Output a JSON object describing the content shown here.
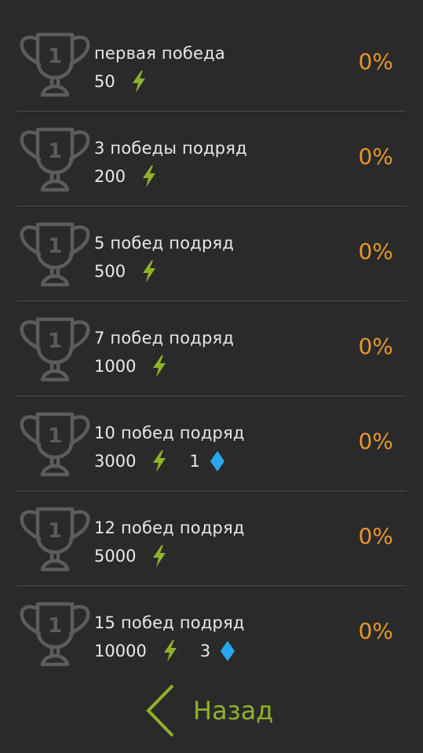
{
  "achievements": [
    {
      "title": "первая победа",
      "energy": "50",
      "gems": "",
      "progress": "0%"
    },
    {
      "title": "3 победы подряд",
      "energy": "200",
      "gems": "",
      "progress": "0%"
    },
    {
      "title": "5 побед подряд",
      "energy": "500",
      "gems": "",
      "progress": "0%"
    },
    {
      "title": "7 побед подряд",
      "energy": "1000",
      "gems": "",
      "progress": "0%"
    },
    {
      "title": "10 побед подряд",
      "energy": "3000",
      "gems": "1",
      "progress": "0%"
    },
    {
      "title": "12 побед подряд",
      "energy": "5000",
      "gems": "",
      "progress": "0%"
    },
    {
      "title": "15 побед подряд",
      "energy": "10000",
      "gems": "3",
      "progress": "0%"
    }
  ],
  "trophy_number": "1",
  "back_label": "Назад",
  "icons": {
    "trophy": "trophy-icon",
    "energy": "lightning-bolt-icon",
    "gem": "diamond-gem-icon",
    "back": "chevron-left-icon"
  },
  "colors": {
    "background": "#2a2a2a",
    "progress": "#e9962b",
    "energy": "#8fb22b",
    "gem": "#29a8ee",
    "back": "#8fb22b",
    "trophy": "#5c5c5c"
  }
}
